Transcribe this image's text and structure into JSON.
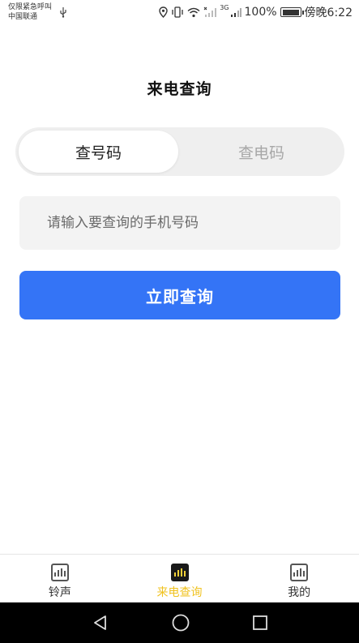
{
  "status_bar": {
    "carrier_line1": "仅限紧急呼叫",
    "carrier_line2": "中国联通",
    "network": "3G",
    "battery": "100%",
    "time": "傍晚6:22"
  },
  "page": {
    "title": "来电查询"
  },
  "tabs": [
    {
      "label": "查号码",
      "active": true
    },
    {
      "label": "查电码",
      "active": false
    }
  ],
  "search": {
    "placeholder": "请输入要查询的手机号码",
    "value": ""
  },
  "submit": {
    "label": "立即查询"
  },
  "colors": {
    "primary": "#3474f6",
    "active_tab": "#f0c21e"
  },
  "bottom_nav": [
    {
      "label": "铃声",
      "icon": "chart-icon",
      "active": false
    },
    {
      "label": "来电查询",
      "icon": "chart-icon",
      "active": true
    },
    {
      "label": "我的",
      "icon": "chart-icon",
      "active": false
    }
  ]
}
